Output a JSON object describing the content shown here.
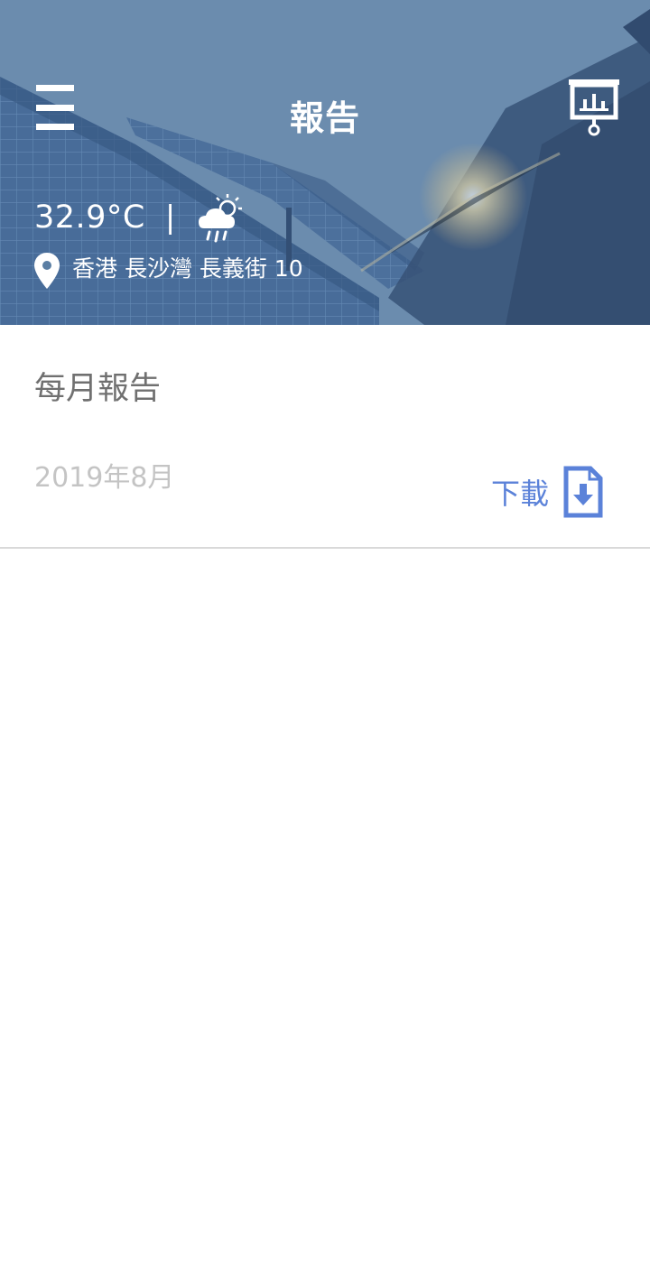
{
  "header": {
    "title": "報告",
    "temperature": "32.9°C",
    "separator": "|",
    "weather_icon": "cloud-rain-sun-icon",
    "location_icon": "map-pin-icon",
    "address": "香港 長沙灣 長義街 10",
    "menu_icon": "hamburger-menu-icon",
    "report_icon": "presentation-chart-icon"
  },
  "report": {
    "section_title": "每月報告",
    "items": [
      {
        "date": "2019年8月",
        "download_label": "下載",
        "download_icon": "file-download-icon"
      }
    ]
  },
  "colors": {
    "accent": "#5b82d9",
    "header_overlay": "#5f83a5",
    "title_text": "#707070",
    "date_text": "#c4c4c4",
    "divider": "#d9d9d9"
  }
}
